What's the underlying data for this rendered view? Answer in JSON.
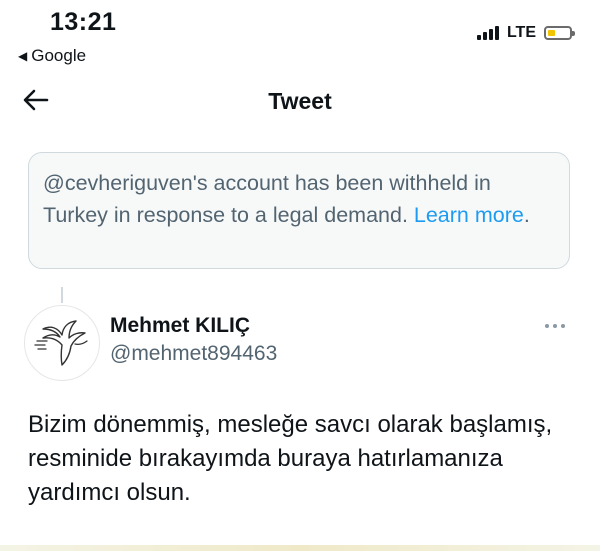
{
  "status_bar": {
    "time": "13:21",
    "back_app": "Google",
    "network": "LTE"
  },
  "header": {
    "title": "Tweet"
  },
  "notice": {
    "text": "@cevheriguven's account has been withheld in Turkey in response to a legal demand. ",
    "link_text": "Learn more",
    "link_suffix": "."
  },
  "tweet": {
    "author_name": "Mehmet KILIÇ",
    "author_handle": "@mehmet894463",
    "text": "Bizim dönemmiş, mesleğe savcı olarak başlamış, resminide bırakayımda buraya hatırlamanıza yardımcı olsun."
  },
  "icons": {
    "back": "arrow-left-icon",
    "more": "more-horizontal-icon",
    "battery_color": "#f2c500"
  },
  "colors": {
    "link": "#1d9bf0",
    "muted": "#536471"
  }
}
